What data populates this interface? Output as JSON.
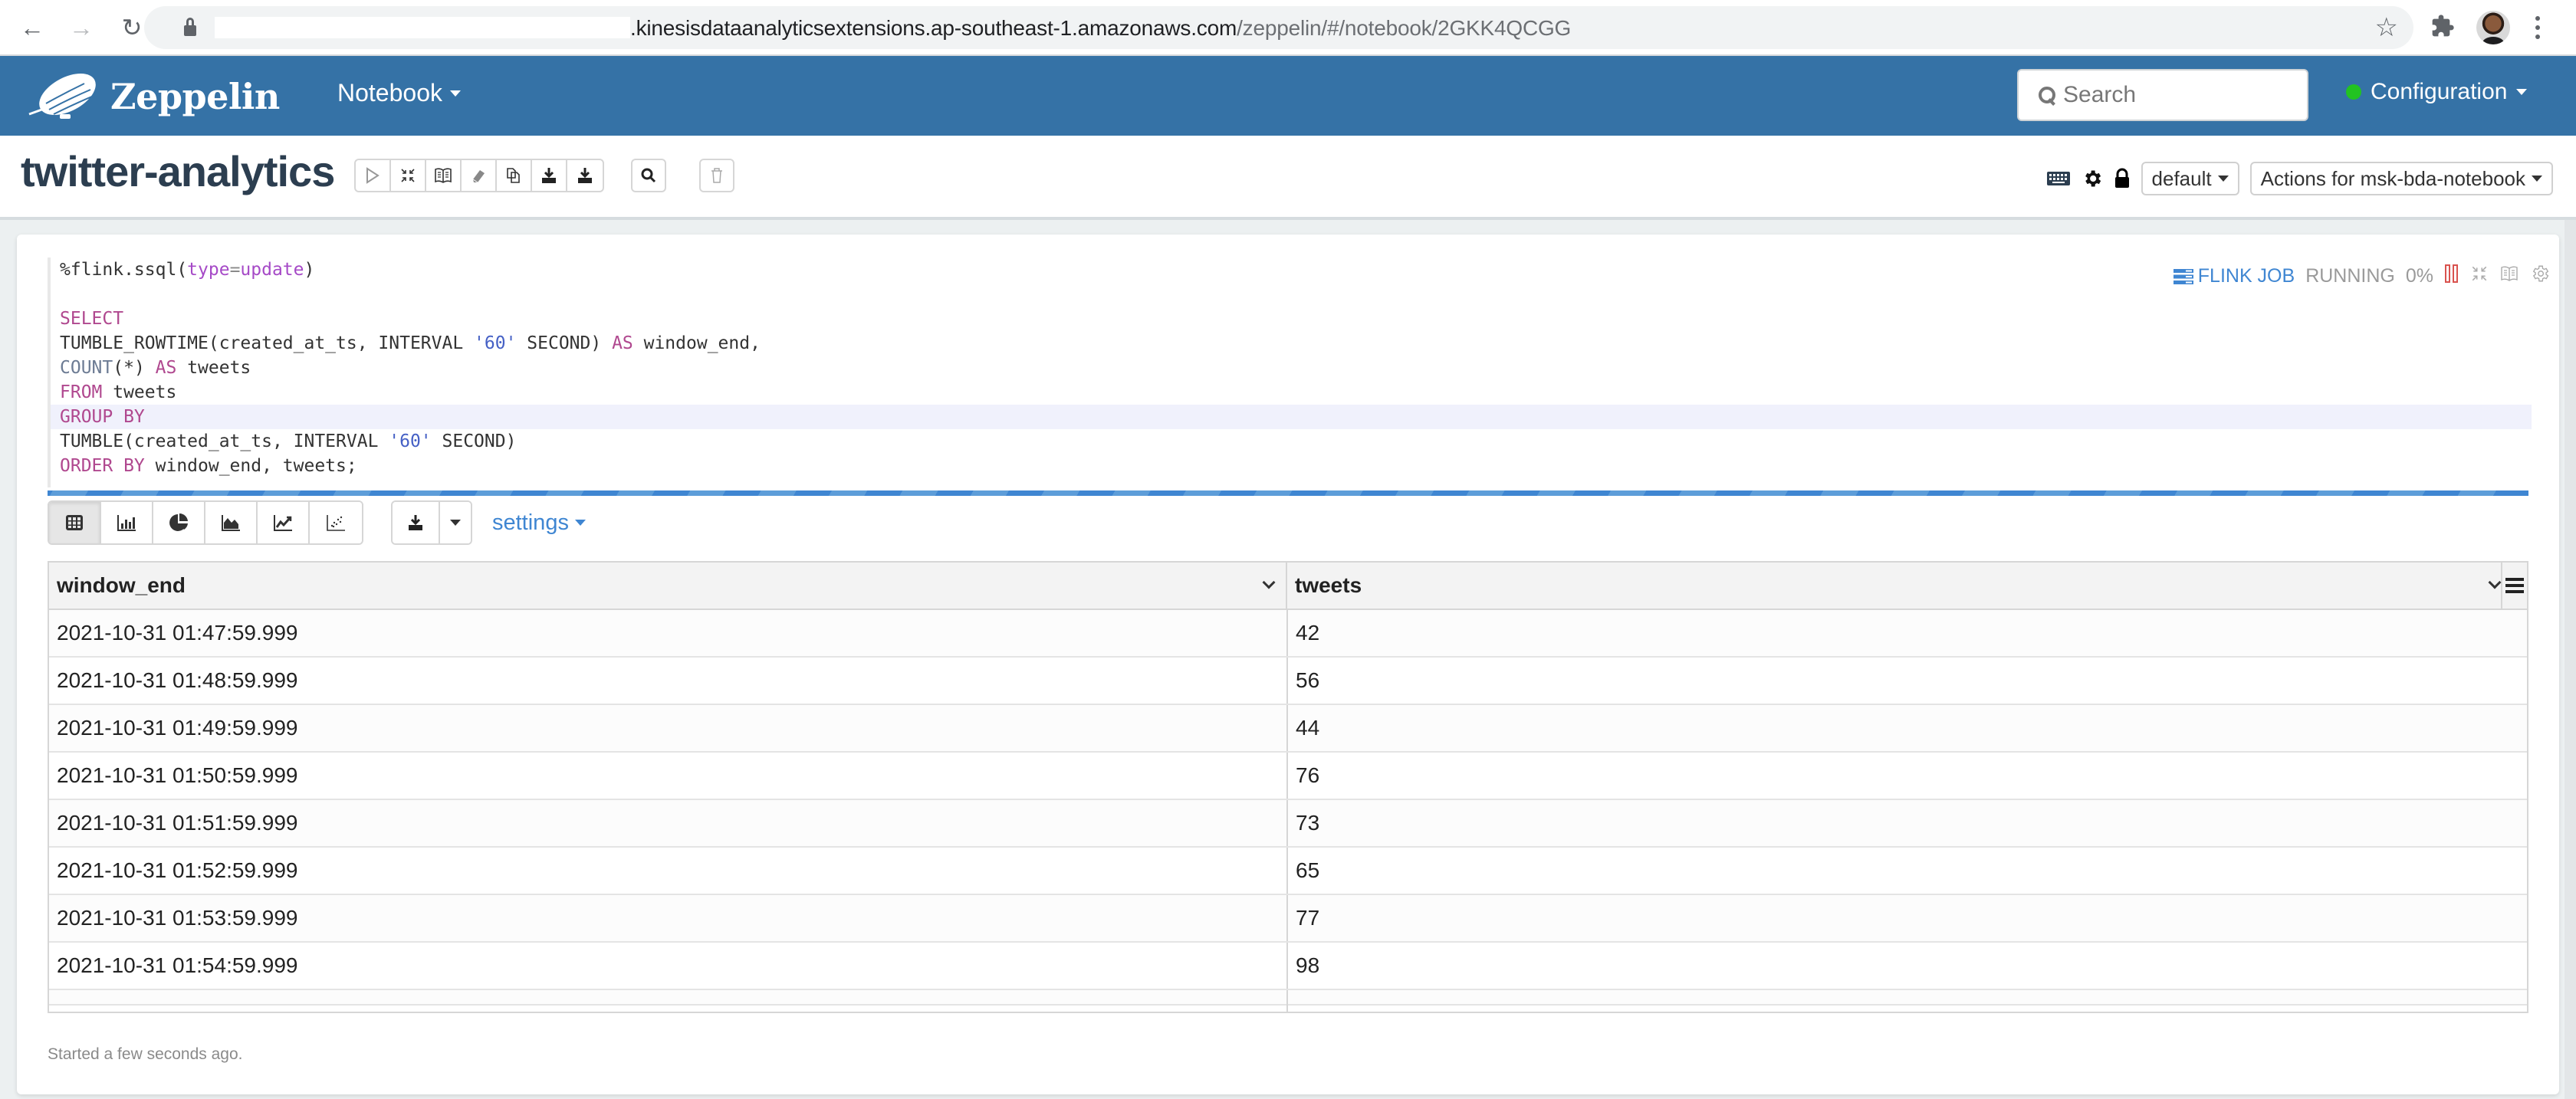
{
  "browser": {
    "url_host": ".kinesisdataanalyticsextensions.ap-southeast-1.amazonaws.com",
    "url_path": "/zeppelin/#/notebook/2GKK4QCGG",
    "icons": [
      "back-arrow-icon",
      "forward-arrow-icon",
      "reload-icon",
      "lock-icon",
      "bookmark-star-icon",
      "extensions-puzzle-icon",
      "profile-avatar",
      "menu-kebab-icon"
    ]
  },
  "navbar": {
    "brand": "Zeppelin",
    "notebook_menu": "Notebook",
    "search_placeholder": "Search",
    "configuration": "Configuration",
    "status_color": "#22c322",
    "bg_color": "#3572a6"
  },
  "notebook": {
    "title": "twitter-analytics",
    "toolbar_icons": [
      "run-all-icon",
      "collapse-code-icon",
      "toggle-output-icon",
      "clear-output-icon",
      "clone-icon",
      "export-icon",
      "export-ipynb-icon"
    ],
    "search_icon": "search-icon",
    "trash_icon": "trash-icon",
    "right_icons": [
      "keyboard-shortcut-icon",
      "settings-gear-icon",
      "lock-icon"
    ],
    "interpreter_dropdown": "default",
    "actions_dropdown": "Actions for msk-bda-notebook"
  },
  "paragraph": {
    "code_lines": [
      {
        "parts": [
          {
            "t": "%flink.ssql(",
            "c": ""
          },
          {
            "t": "type",
            "c": "attr"
          },
          {
            "t": "=",
            "c": "meta"
          },
          {
            "t": "update",
            "c": "attr"
          },
          {
            "t": ")",
            "c": ""
          }
        ]
      },
      {
        "parts": []
      },
      {
        "parts": [
          {
            "t": "SELECT",
            "c": "kw"
          }
        ]
      },
      {
        "parts": [
          {
            "t": "TUMBLE_ROWTIME(created_at_ts, INTERVAL ",
            "c": ""
          },
          {
            "t": "'60'",
            "c": "str"
          },
          {
            "t": " SECOND) ",
            "c": ""
          },
          {
            "t": "AS",
            "c": "kw"
          },
          {
            "t": " window_end,",
            "c": ""
          }
        ]
      },
      {
        "parts": [
          {
            "t": "COUNT",
            "c": "fn"
          },
          {
            "t": "(*) ",
            "c": ""
          },
          {
            "t": "AS",
            "c": "kw"
          },
          {
            "t": " tweets",
            "c": ""
          }
        ]
      },
      {
        "parts": [
          {
            "t": "FROM",
            "c": "kw"
          },
          {
            "t": " tweets",
            "c": ""
          }
        ]
      },
      {
        "parts": [
          {
            "t": "GROUP BY",
            "c": "kw"
          }
        ],
        "active": true
      },
      {
        "parts": [
          {
            "t": "TUMBLE(created_at_ts, INTERVAL ",
            "c": ""
          },
          {
            "t": "'60'",
            "c": "str"
          },
          {
            "t": " SECOND)",
            "c": ""
          }
        ]
      },
      {
        "parts": [
          {
            "t": "ORDER BY",
            "c": "kw"
          },
          {
            "t": " window_end, tweets;",
            "c": ""
          }
        ]
      }
    ],
    "job_label": "FLINK JOB",
    "status": "RUNNING",
    "progress_percent": "0%",
    "status_icons": [
      "cancel-pause-icon",
      "collapse-icon",
      "toggle-editor-icon",
      "paragraph-settings-icon"
    ],
    "viz_buttons": [
      "table-icon",
      "bar-chart-icon",
      "pie-chart-icon",
      "area-chart-icon",
      "line-chart-icon",
      "scatter-chart-icon"
    ],
    "active_viz": "table",
    "download_icon": "download-icon",
    "settings_label": "settings",
    "footer": "Started a few seconds ago."
  },
  "table": {
    "columns": [
      "window_end",
      "tweets"
    ],
    "rows": [
      [
        "2021-10-31 01:47:59.999",
        "42"
      ],
      [
        "2021-10-31 01:48:59.999",
        "56"
      ],
      [
        "2021-10-31 01:49:59.999",
        "44"
      ],
      [
        "2021-10-31 01:50:59.999",
        "76"
      ],
      [
        "2021-10-31 01:51:59.999",
        "73"
      ],
      [
        "2021-10-31 01:52:59.999",
        "65"
      ],
      [
        "2021-10-31 01:53:59.999",
        "77"
      ],
      [
        "2021-10-31 01:54:59.999",
        "98"
      ]
    ]
  }
}
